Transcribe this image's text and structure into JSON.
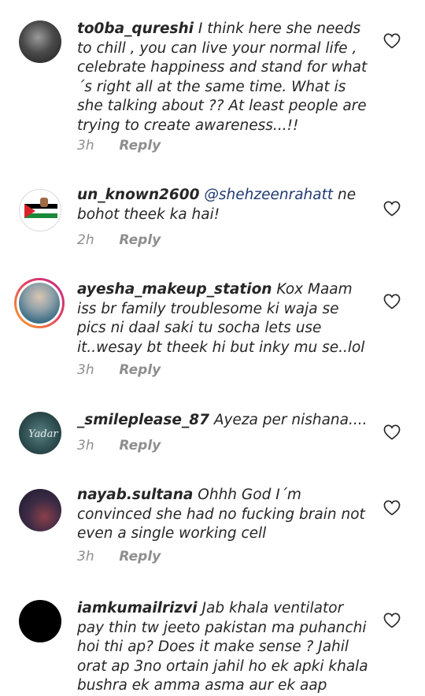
{
  "comments": [
    {
      "username": "to0ba_qureshi",
      "text": "I think here she needs to chill , you can live your normal life , celebrate happiness and stand for what´s right all at the same time. What is she talking about ?? At least people are trying to create awareness...!!",
      "time": "3h",
      "reply": "Reply",
      "avatar": "dark-portrait-avatar"
    },
    {
      "username": "un_known2600",
      "mention": "@shehzeenrahatt",
      "text": "ne bohot theek ka hai!",
      "time": "2h",
      "reply": "Reply",
      "avatar": "palestine-flag-fist-avatar"
    },
    {
      "username": "ayesha_makeup_station",
      "text": "Kox Maam iss br family troublesome ki waja se pics ni daal saki tu socha lets use it..wesay bt theek hi but inky mu se..lol",
      "time": "3h",
      "reply": "Reply",
      "avatar": "story-ring-portrait-avatar"
    },
    {
      "username": "_smileplease_87",
      "text": "Ayeza per nishana....",
      "time": "3h",
      "reply": "Reply",
      "avatar": "teal-script-avatar"
    },
    {
      "username": "nayab.sultana",
      "text": "Ohhh God I´m convinced she had no fucking brain not even a single working cell",
      "time": "3h",
      "reply": "Reply",
      "avatar": "dusk-scene-avatar"
    },
    {
      "username": "iamkumailrizvi",
      "text": "Jab khala ventilator pay thin tw jeeto pakistan ma puhanchi hoi thi ap? Does it make sense ? Jahil orat ap 3no ortain jahil ho ek apki khala bushra ek amma asma aur ek aap",
      "time": "",
      "reply": "",
      "avatar": "black-circle-avatar"
    }
  ],
  "colors": {
    "text": "#262626",
    "meta": "#8e8e8e",
    "mention": "#1f3a73",
    "story_ring_start": "#f9a72b",
    "story_ring_end": "#bc2a8d"
  },
  "icons": {
    "like": "heart-outline-icon"
  }
}
